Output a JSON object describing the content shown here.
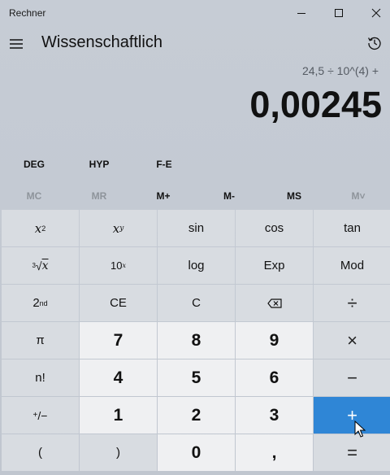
{
  "window": {
    "title": "Rechner"
  },
  "header": {
    "mode_title": "Wissenschaftlich"
  },
  "display": {
    "expression": "24,5 ÷ 10^(4) +",
    "result": "0,00245"
  },
  "modes": [
    "DEG",
    "HYP",
    "F-E"
  ],
  "memory": [
    {
      "label": "MC",
      "enabled": false
    },
    {
      "label": "MR",
      "enabled": false
    },
    {
      "label": "M+",
      "enabled": true
    },
    {
      "label": "M-",
      "enabled": true
    },
    {
      "label": "MS",
      "enabled": true
    },
    {
      "label": "M˅",
      "enabled": false
    }
  ],
  "keys": {
    "x2_base": "x",
    "x2_sup": "2",
    "xy_base": "x",
    "xy_sup": "y",
    "sin": "sin",
    "cos": "cos",
    "tan": "tan",
    "root_idx": "3",
    "root_sym": "√",
    "root_x": "x",
    "tenx_base": "10",
    "tenx_sup": "x",
    "log": "log",
    "exp": "Exp",
    "mod": "Mod",
    "second_base": "2",
    "second_sup": "nd",
    "ce": "CE",
    "c": "C",
    "divide": "÷",
    "pi": "π",
    "n7": "7",
    "n8": "8",
    "n9": "9",
    "multiply": "×",
    "fact": "n!",
    "n4": "4",
    "n5": "5",
    "n6": "6",
    "minus": "−",
    "pm_plus": "+",
    "pm_minus": "/−",
    "n1": "1",
    "n2": "2",
    "n3": "3",
    "plus": "+",
    "lparen": "(",
    "rparen": ")",
    "n0": "0",
    "comma": ",",
    "equals": "="
  },
  "colors": {
    "accent": "#2f86d6",
    "number_key": "#eff0f2",
    "function_key": "#d8dce1"
  }
}
